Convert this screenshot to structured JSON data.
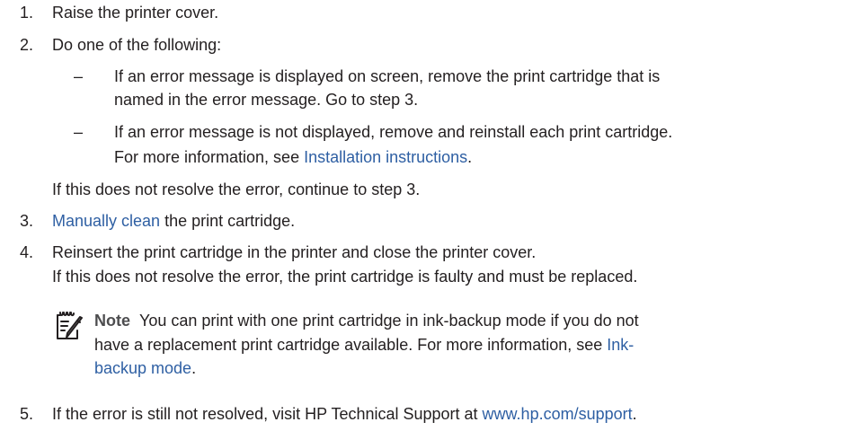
{
  "steps": {
    "s1": {
      "num": "1.",
      "text": "Raise the printer cover."
    },
    "s2": {
      "num": "2.",
      "text": "Do one of the following:",
      "b1": {
        "dash": "–",
        "line1": "If an error message is displayed on screen, remove the print cartridge that is",
        "line2": "named in the error message. Go to step 3."
      },
      "b2": {
        "dash": "–",
        "line1": "If an error message is not displayed, remove and reinstall each print cartridge.",
        "line2_pre": "For more information, see ",
        "line2_link": "Installation instructions",
        "line2_post": "."
      },
      "after": "If this does not resolve the error, continue to step 3."
    },
    "s3": {
      "num": "3.",
      "link": "Manually clean",
      "text": " the print cartridge."
    },
    "s4": {
      "num": "4.",
      "line1": "Reinsert the print cartridge in the printer and close the printer cover.",
      "line2": "If this does not resolve the error, the print cartridge is faulty and must be replaced."
    },
    "s5": {
      "num": "5.",
      "pre": "If the error is still not resolved, visit HP Technical Support at ",
      "link": "www.hp.com/support",
      "post": "."
    }
  },
  "note": {
    "icon": "note-pencil-icon",
    "label": "Note",
    "line1": "You can print with one print cartridge in ink-backup mode if you do not",
    "line2_pre": "have a replacement print cartridge available. For more information, see ",
    "line2_link": "Ink-",
    "line3_link": "backup mode",
    "line3_post": "."
  },
  "colors": {
    "text": "#231f20",
    "link": "#2e5fa3"
  }
}
